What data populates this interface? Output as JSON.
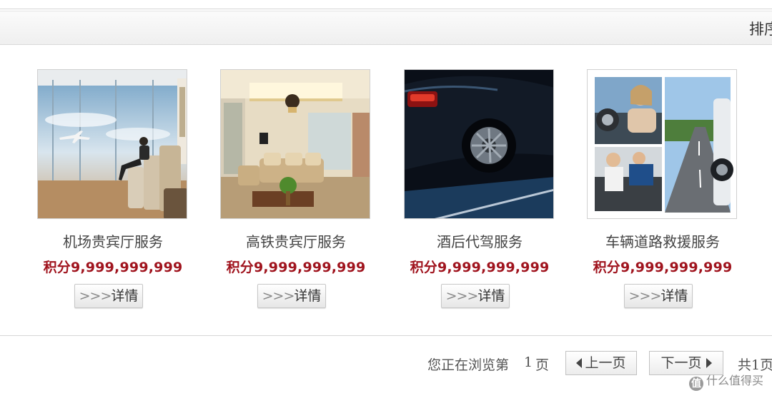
{
  "sort_bar": {
    "label": "排序"
  },
  "products": [
    {
      "title": "机场贵宾厅服务",
      "points": "积分9,999,999,999",
      "detail_arrows": ">>>",
      "detail_label": "详情",
      "image_icon": "airport-lounge-photo"
    },
    {
      "title": "高铁贵宾厅服务",
      "points": "积分9,999,999,999",
      "detail_arrows": ">>>",
      "detail_label": "详情",
      "image_icon": "train-vip-lounge-photo"
    },
    {
      "title": "酒后代驾服务",
      "points": "积分9,999,999,999",
      "detail_arrows": ">>>",
      "detail_label": "详情",
      "image_icon": "car-night-photo"
    },
    {
      "title": "车辆道路救援服务",
      "points": "积分9,999,999,999",
      "detail_arrows": ">>>",
      "detail_label": "详情",
      "image_icon": "roadside-assistance-collage"
    }
  ],
  "pager": {
    "browsing_prefix": "您正在浏览第",
    "current_page": "1",
    "page_suffix": "页",
    "prev_label": "上一页",
    "next_label": "下一页",
    "total_label": "共1页"
  },
  "watermark": {
    "icon": "值",
    "text": "什么值得买"
  },
  "colors": {
    "points_red": "#a0141e",
    "text_gray": "#444444",
    "border_gray": "#c7c7c7"
  }
}
